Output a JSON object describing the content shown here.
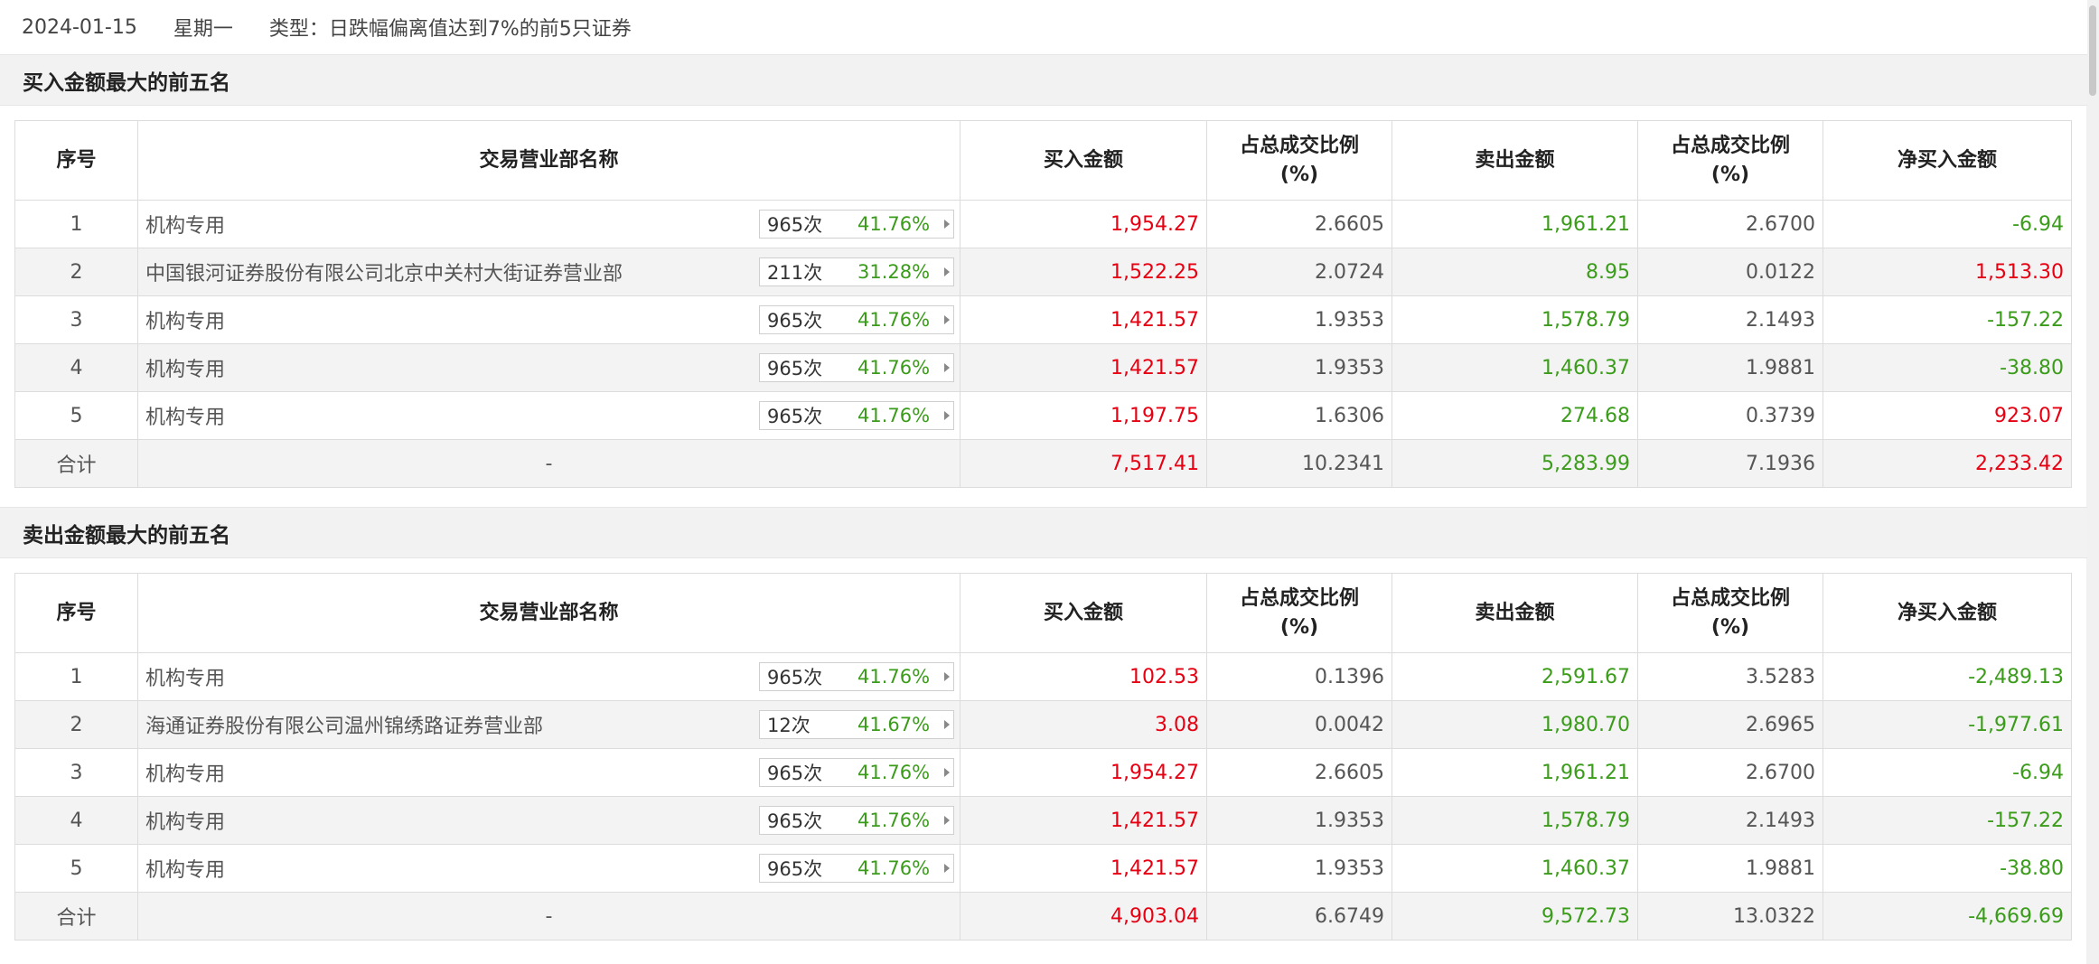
{
  "header": {
    "date": "2024-01-15",
    "weekday": "星期一",
    "type_text": "类型：日跌幅偏离值达到7%的前5只证券"
  },
  "columns": {
    "rank": "序号",
    "branch": "交易营业部名称",
    "buy": "买入金额",
    "buy_ratio_l1": "占总成交比例",
    "buy_ratio_l2": "(%)",
    "sell": "卖出金额",
    "sell_ratio_l1": "占总成交比例",
    "sell_ratio_l2": "(%)",
    "net": "净买入金额"
  },
  "buy_section": {
    "title": "买入金额最大的前五名",
    "rows": [
      {
        "rank": "1",
        "name": "机构专用",
        "count": "965次",
        "pct": "41.76%",
        "buy": "1,954.27",
        "buy_ratio": "2.6605",
        "sell": "1,961.21",
        "sell_ratio": "2.6700",
        "net": "-6.94"
      },
      {
        "rank": "2",
        "name": "中国银河证券股份有限公司北京中关村大街证券营业部",
        "count": "211次",
        "pct": "31.28%",
        "buy": "1,522.25",
        "buy_ratio": "2.0724",
        "sell": "8.95",
        "sell_ratio": "0.0122",
        "net": "1,513.30"
      },
      {
        "rank": "3",
        "name": "机构专用",
        "count": "965次",
        "pct": "41.76%",
        "buy": "1,421.57",
        "buy_ratio": "1.9353",
        "sell": "1,578.79",
        "sell_ratio": "2.1493",
        "net": "-157.22"
      },
      {
        "rank": "4",
        "name": "机构专用",
        "count": "965次",
        "pct": "41.76%",
        "buy": "1,421.57",
        "buy_ratio": "1.9353",
        "sell": "1,460.37",
        "sell_ratio": "1.9881",
        "net": "-38.80"
      },
      {
        "rank": "5",
        "name": "机构专用",
        "count": "965次",
        "pct": "41.76%",
        "buy": "1,197.75",
        "buy_ratio": "1.6306",
        "sell": "274.68",
        "sell_ratio": "0.3739",
        "net": "923.07"
      }
    ],
    "total": {
      "label": "合计",
      "name": "-",
      "buy": "7,517.41",
      "buy_ratio": "10.2341",
      "sell": "5,283.99",
      "sell_ratio": "7.1936",
      "net": "2,233.42"
    }
  },
  "sell_section": {
    "title": "卖出金额最大的前五名",
    "rows": [
      {
        "rank": "1",
        "name": "机构专用",
        "count": "965次",
        "pct": "41.76%",
        "buy": "102.53",
        "buy_ratio": "0.1396",
        "sell": "2,591.67",
        "sell_ratio": "3.5283",
        "net": "-2,489.13"
      },
      {
        "rank": "2",
        "name": "海通证券股份有限公司温州锦绣路证券营业部",
        "count": "12次",
        "pct": "41.67%",
        "buy": "3.08",
        "buy_ratio": "0.0042",
        "sell": "1,980.70",
        "sell_ratio": "2.6965",
        "net": "-1,977.61"
      },
      {
        "rank": "3",
        "name": "机构专用",
        "count": "965次",
        "pct": "41.76%",
        "buy": "1,954.27",
        "buy_ratio": "2.6605",
        "sell": "1,961.21",
        "sell_ratio": "2.6700",
        "net": "-6.94"
      },
      {
        "rank": "4",
        "name": "机构专用",
        "count": "965次",
        "pct": "41.76%",
        "buy": "1,421.57",
        "buy_ratio": "1.9353",
        "sell": "1,578.79",
        "sell_ratio": "2.1493",
        "net": "-157.22"
      },
      {
        "rank": "5",
        "name": "机构专用",
        "count": "965次",
        "pct": "41.76%",
        "buy": "1,421.57",
        "buy_ratio": "1.9353",
        "sell": "1,460.37",
        "sell_ratio": "1.9881",
        "net": "-38.80"
      }
    ],
    "total": {
      "label": "合计",
      "name": "-",
      "buy": "4,903.04",
      "buy_ratio": "6.6749",
      "sell": "9,572.73",
      "sell_ratio": "13.0322",
      "net": "-4,669.69"
    }
  },
  "colors": {
    "positive": "#e60012",
    "negative": "#3a9c1a",
    "neutral": "#555555",
    "row_alt_bg": "#f3f3f3",
    "section_bg": "#f2f2f2"
  }
}
